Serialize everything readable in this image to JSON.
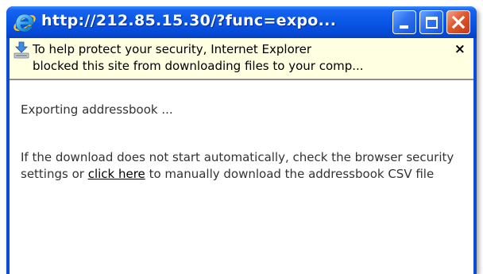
{
  "window": {
    "title": "http://212.85.15.30/?func=expo...",
    "buttons": {
      "minimize": "minimize",
      "maximize": "maximize",
      "close": "close"
    }
  },
  "infobar": {
    "line1": "To help protect your security, Internet Explorer",
    "line2": "blocked this site from downloading files to your comp...",
    "close_glyph": "×",
    "icon": "download-warning-icon"
  },
  "content": {
    "status": "Exporting addressbook ...",
    "message_before": "If the download does not start automatically, check the browser security settings or ",
    "link_text": "click here",
    "message_after": " to manually download the addressbook CSV file"
  },
  "colors": {
    "titlebar": "#0a56e6",
    "infobar_bg": "#ffffe1",
    "close_button": "#e0582e"
  }
}
